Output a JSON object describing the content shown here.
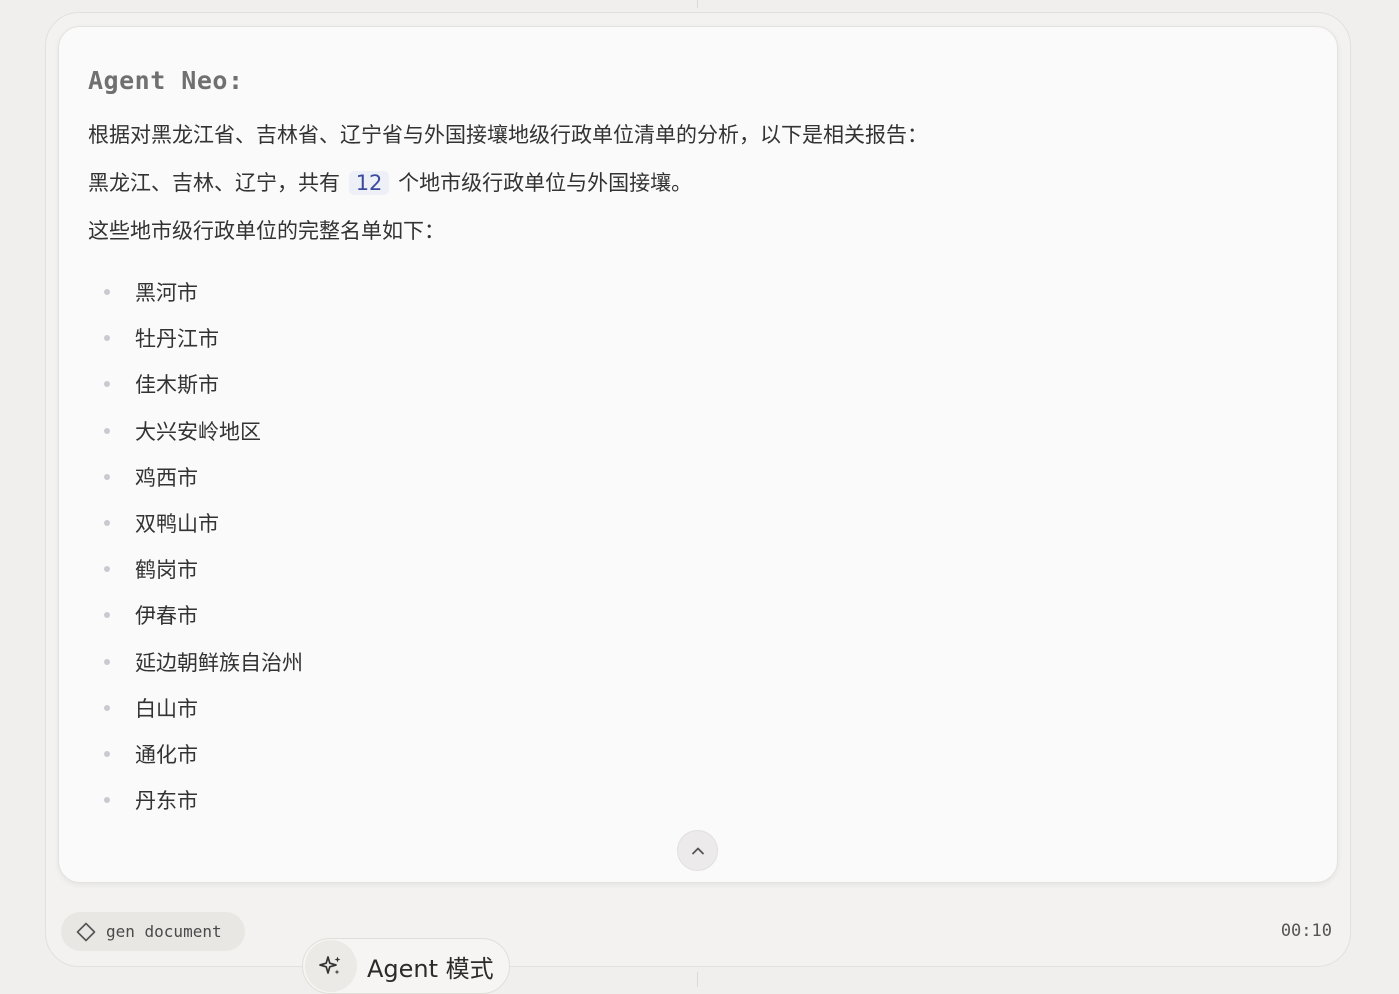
{
  "message": {
    "agent_name": "Agent Neo:",
    "intro": "根据对黑龙江省、吉林省、辽宁省与外国接壤地级行政单位清单的分析，以下是相关报告：",
    "count_prefix": "黑龙江、吉林、辽宁，共有",
    "count_value": "12",
    "count_suffix": "个地市级行政单位与外国接壤。",
    "list_intro": "这些地市级行政单位的完整名单如下：",
    "regions": [
      "黑河市",
      "牡丹江市",
      "佳木斯市",
      "大兴安岭地区",
      "鸡西市",
      "双鸭山市",
      "鹤岗市",
      "伊春市",
      "延边朝鲜族自治州",
      "白山市",
      "通化市",
      "丹东市"
    ]
  },
  "footer": {
    "tool_chip_label": "gen document",
    "timer": "00:10",
    "mode_label": "Agent 模式"
  },
  "icons": {
    "collapse": "chevron-up-icon",
    "tool": "diamond-icon",
    "mode": "sparkle-icon"
  },
  "colors": {
    "count_highlight_bg": "#eef0f7",
    "count_highlight_text": "#3c4a9e"
  }
}
